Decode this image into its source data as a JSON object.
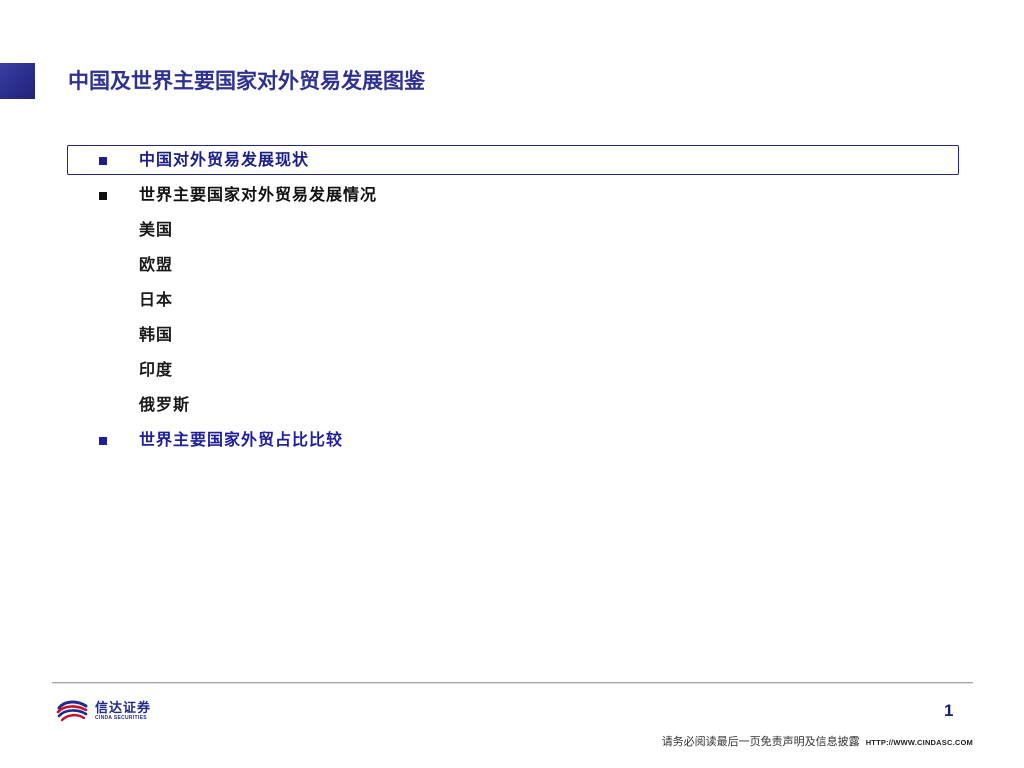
{
  "slide": {
    "title": "中国及世界主要国家对外贸易发展图鉴",
    "page_number": "1"
  },
  "agenda": {
    "items": [
      {
        "label": "中国对外贸易发展现状",
        "level": 1,
        "bullet": true,
        "current": true,
        "color": "#1c1f8a"
      },
      {
        "label": "世界主要国家对外贸易发展情况",
        "level": 1,
        "bullet": true,
        "current": false,
        "color": "#111111"
      },
      {
        "label": "美国",
        "level": 2,
        "bullet": false,
        "current": false,
        "color": "#1a1a1a"
      },
      {
        "label": "欧盟",
        "level": 2,
        "bullet": false,
        "current": false,
        "color": "#1a1a1a"
      },
      {
        "label": "日本",
        "level": 2,
        "bullet": false,
        "current": false,
        "color": "#1a1a1a"
      },
      {
        "label": "韩国",
        "level": 2,
        "bullet": false,
        "current": false,
        "color": "#1a1a1a"
      },
      {
        "label": "印度",
        "level": 2,
        "bullet": false,
        "current": false,
        "color": "#1a1a1a"
      },
      {
        "label": "俄罗斯",
        "level": 2,
        "bullet": false,
        "current": false,
        "color": "#1a1a1a"
      },
      {
        "label": "世界主要国家外贸占比比较",
        "level": 1,
        "bullet": true,
        "current": false,
        "color": "#1f1f9e"
      }
    ]
  },
  "footer": {
    "logo": {
      "icon": "cinda-wave-logo-icon",
      "name_cn": "信达证券",
      "name_en": "CINDA SECURITIES"
    },
    "disclaimer": "请务必阅读最后一页免责声明及信息披露",
    "url": "HTTP://WWW.CINDASC.COM"
  },
  "theme": {
    "accent": "#2e3192",
    "corner_block": "#2b2d8c",
    "highlight_border": "#23258c",
    "rule": "#a6a6a6",
    "logo_blue": "#1f2a8c",
    "logo_red": "#c8102e"
  }
}
